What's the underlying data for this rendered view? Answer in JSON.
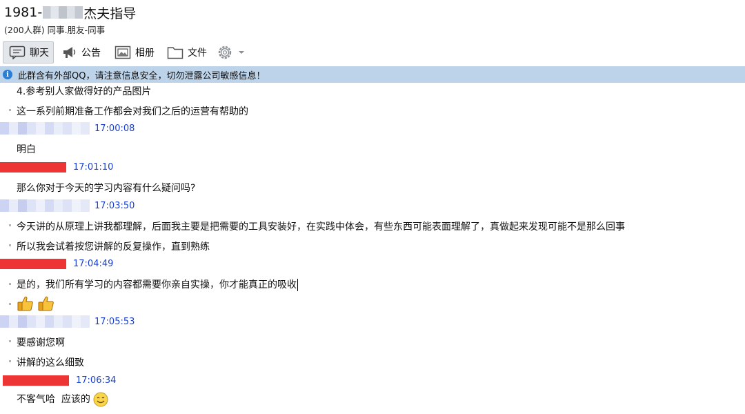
{
  "header": {
    "title_prefix": "1981-",
    "title_suffix": "杰夫指导",
    "subtitle": "(200人群) 同事.朋友-同事"
  },
  "toolbar": {
    "tabs": [
      {
        "label": "聊天",
        "icon": "chat-bubble-icon"
      },
      {
        "label": "公告",
        "icon": "megaphone-icon"
      },
      {
        "label": "相册",
        "icon": "photo-album-icon"
      },
      {
        "label": "文件",
        "icon": "folder-icon"
      }
    ],
    "settings_icon": "gear-icon"
  },
  "notice": {
    "text": "此群含有外部QQ，请注意信息安全，切勿泄露公司敏感信息！",
    "icon": "info-icon",
    "color": "#bcd3ea"
  },
  "messages": [
    {
      "text": "4.参考别人家做得好的产品图片"
    },
    {
      "text": "这一系列前期准备工作都会对我们之后的运营有帮助的"
    },
    {
      "time": "17:00:08"
    },
    {
      "text": "明白"
    },
    {
      "time": "17:01:10"
    },
    {
      "text": "那么你对于今天的学习内容有什么疑问吗?"
    },
    {
      "time": "17:03:50"
    },
    {
      "text": "今天讲的从原理上讲我都理解，后面我主要是把需要的工具安装好，在实践中体会，有些东西可能表面理解了，真做起来发现可能不是那么回事"
    },
    {
      "text": "所以我会试着按您讲解的反复操作，直到熟练"
    },
    {
      "time": "17:04:49"
    },
    {
      "text": "是的，我们所有学习的内容都需要你亲自实操，你才能真正的吸收"
    },
    {
      "emoji": "thumbs-up-icon"
    },
    {
      "time": "17:05:53"
    },
    {
      "text": "要感谢您啊"
    },
    {
      "text": "讲解的这么细致"
    },
    {
      "time": "17:06:34"
    },
    {
      "text": "不客气哈  应该的",
      "emoji": "smile-icon"
    }
  ],
  "colors": {
    "time_text": "#1a3fcf",
    "redacted_red": "#ee3535",
    "notice_bg": "#bcd3ea"
  }
}
